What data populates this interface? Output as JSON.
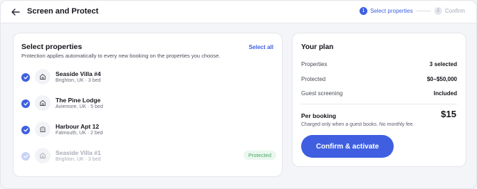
{
  "header": {
    "title": "Screen and Protect",
    "steps": [
      {
        "num": "1",
        "label": "Select properties"
      },
      {
        "num": "2",
        "label": "Confirm"
      }
    ]
  },
  "properties_section": {
    "title": "Select properties",
    "subtitle": "Protection applies automatically to every new booking on the properties you choose.",
    "select_all_label": "Select all",
    "items": [
      {
        "name": "Seaside Villa #4",
        "location": "Brighton, UK · 3 bed"
      },
      {
        "name": "The Pine Lodge",
        "location": "Aviemore, UK · 5 bed"
      },
      {
        "name": "Harbour Apt 12",
        "location": "Falmouth, UK · 2 bed"
      },
      {
        "name": "Seaside Villa #1",
        "location": "Brighton, UK · 3 bed",
        "badge": "Protected"
      }
    ]
  },
  "plan": {
    "title": "Your plan",
    "rows": [
      {
        "label": "Properties",
        "value": "3 selected"
      },
      {
        "label": "Protected",
        "value": "$0–$50,000"
      },
      {
        "label": "Guest screening",
        "value": "Included"
      }
    ],
    "per_booking_label": "Per booking",
    "price": "$15",
    "note": "Charged only when a guest books. No monthly fee.",
    "cta_label": "Confirm & activate"
  },
  "colors": {
    "accent": "#3f5fe0",
    "success_text": "#4ea86a",
    "success_bg": "#eaf7ee"
  }
}
